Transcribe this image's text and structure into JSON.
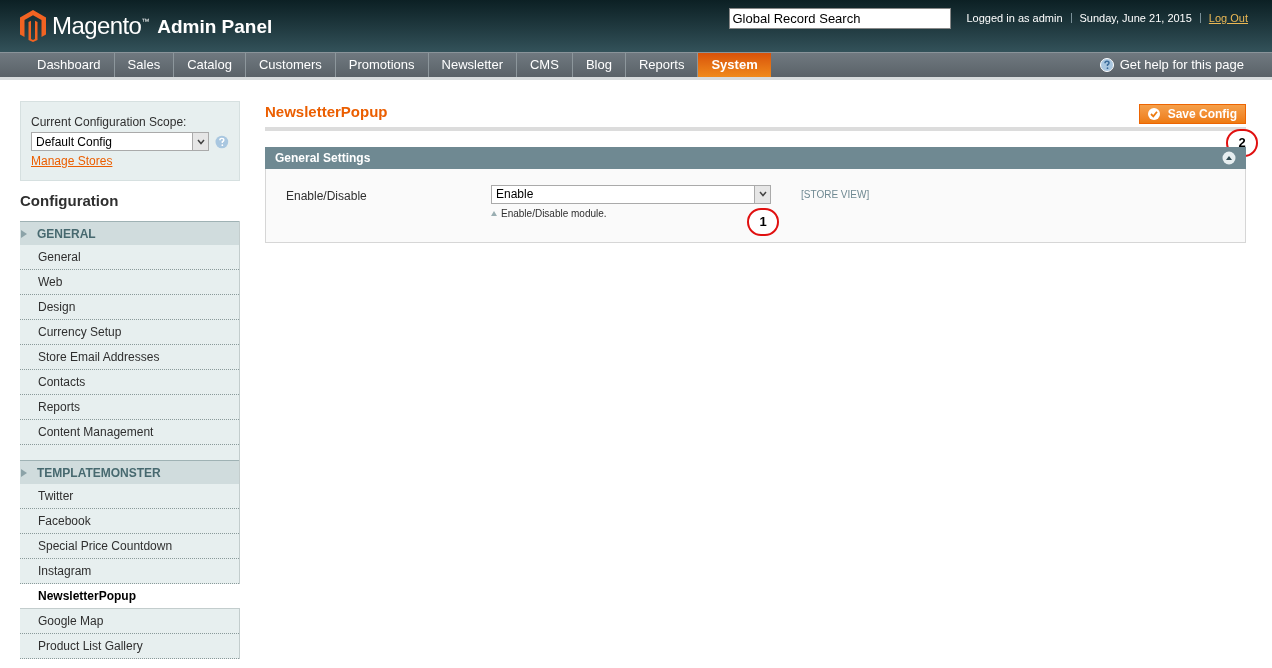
{
  "header": {
    "logo_word": "Magento",
    "logo_tm": "™",
    "logo_suffix": "Admin Panel",
    "search": {
      "value": "Global Record Search"
    },
    "user": "Logged in as admin",
    "date": "Sunday, June 21, 2015",
    "logout": "Log Out"
  },
  "nav": {
    "items": [
      {
        "label": "Dashboard",
        "selected": false
      },
      {
        "label": "Sales",
        "selected": false
      },
      {
        "label": "Catalog",
        "selected": false
      },
      {
        "label": "Customers",
        "selected": false
      },
      {
        "label": "Promotions",
        "selected": false
      },
      {
        "label": "Newsletter",
        "selected": false
      },
      {
        "label": "CMS",
        "selected": false
      },
      {
        "label": "Blog",
        "selected": false
      },
      {
        "label": "Reports",
        "selected": false
      },
      {
        "label": "System",
        "selected": true
      }
    ],
    "help": "Get help for this page"
  },
  "scope": {
    "label": "Current Configuration Scope:",
    "value": "Default Config",
    "link": "Manage Stores"
  },
  "sidebar": {
    "title": "Configuration",
    "groups": [
      {
        "title": "GENERAL",
        "items": [
          {
            "label": "General",
            "selected": false
          },
          {
            "label": "Web",
            "selected": false
          },
          {
            "label": "Design",
            "selected": false
          },
          {
            "label": "Currency Setup",
            "selected": false
          },
          {
            "label": "Store Email Addresses",
            "selected": false
          },
          {
            "label": "Contacts",
            "selected": false
          },
          {
            "label": "Reports",
            "selected": false
          },
          {
            "label": "Content Management",
            "selected": false
          }
        ]
      },
      {
        "title": "TEMPLATEMONSTER",
        "items": [
          {
            "label": "Twitter",
            "selected": false
          },
          {
            "label": "Facebook",
            "selected": false
          },
          {
            "label": "Special Price Countdown",
            "selected": false
          },
          {
            "label": "Instagram",
            "selected": false
          },
          {
            "label": "NewsletterPopup",
            "selected": true
          },
          {
            "label": "Google Map",
            "selected": false
          },
          {
            "label": "Product List Gallery",
            "selected": false
          }
        ]
      }
    ]
  },
  "page": {
    "title": "NewsletterPopup",
    "save_button": "Save Config",
    "save_marker": "2",
    "section": {
      "title": "General Settings",
      "expanded": true,
      "fields": [
        {
          "label": "Enable/Disable",
          "value": "Enable",
          "note": "Enable/Disable module.",
          "scope": "[STORE VIEW]",
          "marker": "1"
        }
      ]
    }
  }
}
